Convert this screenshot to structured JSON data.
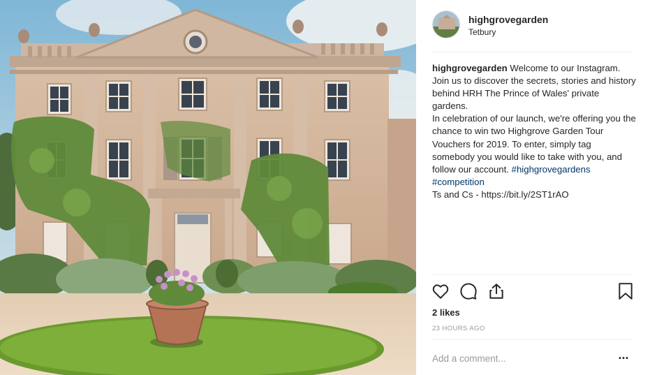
{
  "post": {
    "username": "highgrovegarden",
    "location": "Tetbury",
    "caption_username": "highgrovegarden",
    "caption_intro": "Welcome to our Instagram. Join us to discover the secrets, stories and history behind HRH The Prince of Wales' private gardens.",
    "caption_body": "In celebration of our launch, we're offering you the chance to win two Highgrove Garden Tour Vouchers for 2019. To enter, simply tag somebody you would like to take with you, and follow our account.",
    "hashtag_1": "#highgrovegardens",
    "hashtag_2": "#competition",
    "terms": "Ts and Cs - https://bit.ly/2ST1rAO",
    "likes": "2 likes",
    "timestamp": "23 HOURS AGO",
    "comment_placeholder": "Add a comment...",
    "more_label": "..."
  },
  "icons": {
    "like": "heart-icon",
    "comment": "comment-bubble-icon",
    "share": "share-icon",
    "save": "bookmark-icon"
  },
  "colors": {
    "text": "#262626",
    "secondary": "#999999",
    "hashtag": "#003569",
    "divider": "#efefef"
  }
}
